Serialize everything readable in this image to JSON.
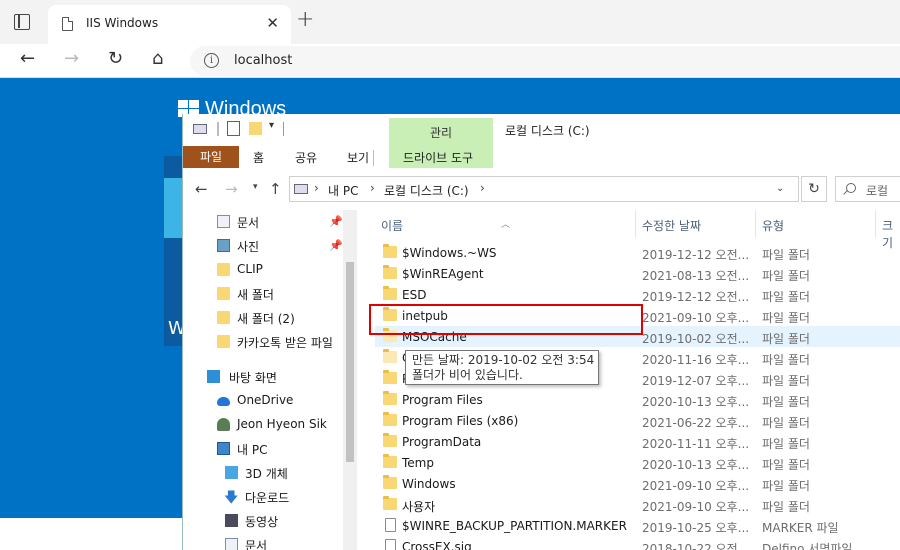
{
  "browser": {
    "tab_title": "IIS Windows",
    "tab_close": "✕",
    "new_tab": "+",
    "url": "localhost",
    "info_glyph": "i",
    "back_glyph": "←",
    "forward_glyph": "→",
    "refresh_glyph": "↻",
    "home_glyph": "⌂"
  },
  "page": {
    "windows_text": "Windows",
    "w_letter": "W"
  },
  "explorer": {
    "title": "로컬 디스크 (C:)",
    "context_tab": "관리",
    "ribbon_tabs": [
      "파일",
      "홈",
      "공유",
      "보기",
      "드라이브 도구"
    ],
    "address": {
      "segments": [
        "내 PC",
        "로컬 디스크 (C:)"
      ],
      "search_placeholder": "로컬"
    },
    "nav_items": [
      {
        "label": "문서",
        "icon": "document-icon",
        "pinned": true
      },
      {
        "label": "사진",
        "icon": "pictures-icon",
        "pinned": true
      },
      {
        "label": "CLIP",
        "icon": "folder-icon"
      },
      {
        "label": "새 폴더",
        "icon": "folder-icon"
      },
      {
        "label": "새 폴더 (2)",
        "icon": "folder-icon"
      },
      {
        "label": "카카오톡 받은 파일",
        "icon": "folder-icon"
      },
      {
        "label": "바탕 화면",
        "icon": "desktop-icon"
      },
      {
        "label": "OneDrive",
        "icon": "cloud-icon"
      },
      {
        "label": "Jeon Hyeon Sik",
        "icon": "user-icon"
      },
      {
        "label": "내 PC",
        "icon": "pc-icon"
      },
      {
        "label": "3D 개체",
        "icon": "cube-icon"
      },
      {
        "label": "다운로드",
        "icon": "download-icon"
      },
      {
        "label": "동영상",
        "icon": "video-icon"
      },
      {
        "label": "문서",
        "icon": "document-icon"
      }
    ],
    "columns": {
      "name": "이름",
      "date": "수정한 날짜",
      "type": "유형",
      "size": "크기"
    },
    "files": [
      {
        "name": "$Windows.~WS",
        "date": "2019-12-12 오전...",
        "type": "파일 폴더"
      },
      {
        "name": "$WinREAgent",
        "date": "2021-08-13 오전...",
        "type": "파일 폴더"
      },
      {
        "name": "ESD",
        "date": "2019-12-12 오전...",
        "type": "파일 폴더"
      },
      {
        "name": "inetpub",
        "date": "2021-09-10 오후...",
        "type": "파일 폴더"
      },
      {
        "name": "MSOCache",
        "date": "2019-10-02 오전...",
        "type": "파일 폴더"
      },
      {
        "name": "O",
        "date": "2020-11-16 오후...",
        "type": "파일 폴더"
      },
      {
        "name": "P",
        "date": "2019-12-07 오후...",
        "type": "파일 폴더"
      },
      {
        "name": "Program Files",
        "date": "2020-10-13 오후...",
        "type": "파일 폴더"
      },
      {
        "name": "Program Files (x86)",
        "date": "2021-06-22 오후...",
        "type": "파일 폴더"
      },
      {
        "name": "ProgramData",
        "date": "2020-11-11 오후...",
        "type": "파일 폴더"
      },
      {
        "name": "Temp",
        "date": "2020-10-13 오후...",
        "type": "파일 폴더"
      },
      {
        "name": "Windows",
        "date": "2021-09-10 오후...",
        "type": "파일 폴더"
      },
      {
        "name": "사용자",
        "date": "2021-09-10 오후...",
        "type": "파일 폴더"
      },
      {
        "name": "$WINRE_BACKUP_PARTITION.MARKER",
        "date": "2019-10-25 오후...",
        "type": "MARKER 파일"
      },
      {
        "name": "CrossEX.sig",
        "date": "2018-10-22 오전...",
        "type": "Delfino 서명파일"
      }
    ],
    "tooltip": {
      "line1": "만든 날짜: 2019-10-02 오전 3:54",
      "line2": "폴더가 비어 있습니다."
    }
  },
  "colors": {
    "iis_blue": "#0072c6",
    "highlight_red": "#e00000",
    "file_tab": "#a0521c",
    "context_green": "#c9efb6"
  }
}
